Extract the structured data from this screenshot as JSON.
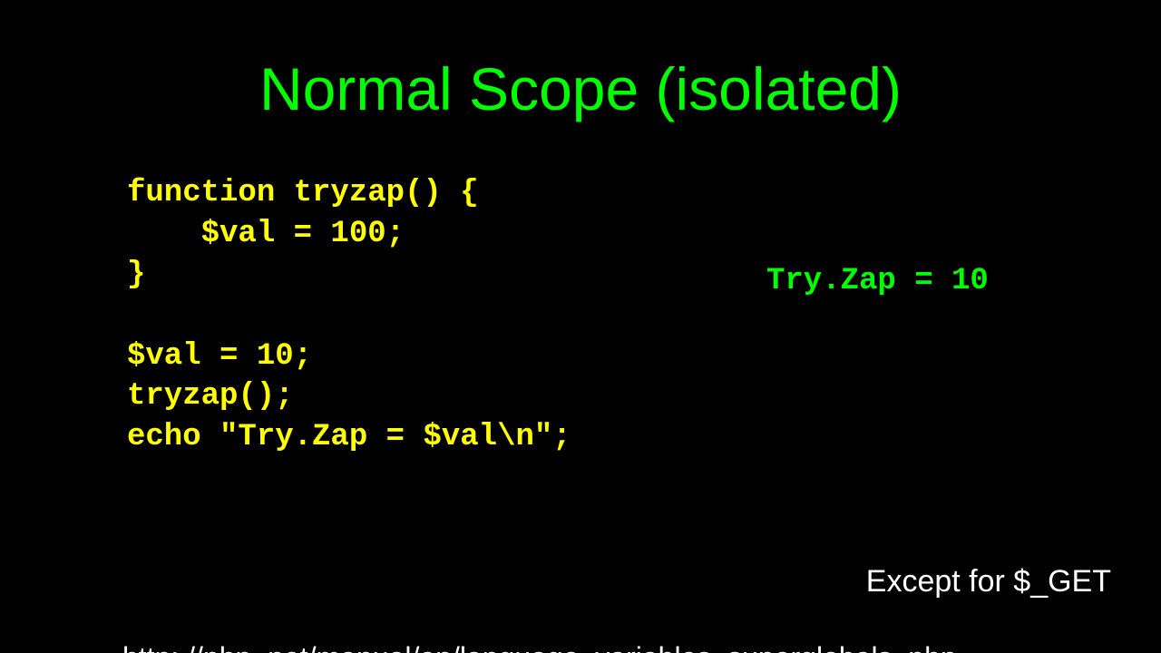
{
  "title": "Normal Scope (isolated)",
  "code": "function tryzap() {\n    $val = 100;\n}\n\n$val = 10;\ntryzap();\necho \"Try.Zap = $val\\n\";",
  "output": "Try.Zap = 10",
  "note": "Except for $_GET",
  "url": "http: //php. net/manual/en/language. variables. superglobals. php"
}
